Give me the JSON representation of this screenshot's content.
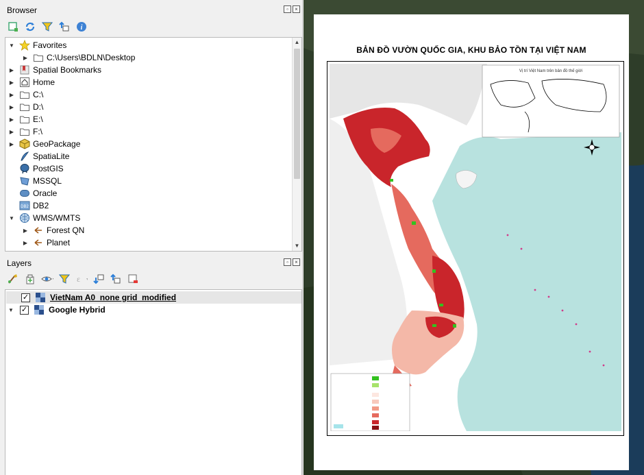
{
  "browser": {
    "title": "Browser",
    "toolbar_icons": [
      "add-layer-icon",
      "refresh-icon",
      "filter-icon",
      "collapse-all-icon",
      "info-icon"
    ],
    "items": [
      {
        "label": "Favorites",
        "icon": "star-icon",
        "expanded": true
      },
      {
        "label": "C:\\Users\\BDLN\\Desktop",
        "icon": "folder-icon"
      },
      {
        "label": "Spatial Bookmarks",
        "icon": "bookmark-icon"
      },
      {
        "label": "Home",
        "icon": "home-icon"
      },
      {
        "label": "C:\\",
        "icon": "folder-icon"
      },
      {
        "label": "D:\\",
        "icon": "folder-icon"
      },
      {
        "label": "E:\\",
        "icon": "folder-icon"
      },
      {
        "label": "F:\\",
        "icon": "folder-icon"
      },
      {
        "label": "GeoPackage",
        "icon": "geopackage-icon"
      },
      {
        "label": "SpatiaLite",
        "icon": "spatialite-icon"
      },
      {
        "label": "PostGIS",
        "icon": "postgis-icon"
      },
      {
        "label": "MSSQL",
        "icon": "mssql-icon"
      },
      {
        "label": "Oracle",
        "icon": "oracle-icon"
      },
      {
        "label": "DB2",
        "icon": "db2-icon"
      },
      {
        "label": "WMS/WMTS",
        "icon": "globe-icon",
        "expanded": true
      },
      {
        "label": "Forest QN",
        "icon": "wms-layer-icon"
      },
      {
        "label": "Planet",
        "icon": "wms-layer-icon"
      }
    ]
  },
  "layers": {
    "title": "Layers",
    "toolbar_icons": [
      "style-icon",
      "add-group-icon",
      "visibility-icon",
      "filter-icon",
      "expression-icon",
      "expand-all-icon",
      "collapse-all-icon",
      "remove-layer-icon"
    ],
    "items": [
      {
        "label": "VietNam A0_none grid_modified",
        "checked": true,
        "icon": "raster-icon"
      },
      {
        "label": "Google Hybrid",
        "checked": true,
        "icon": "raster-icon"
      }
    ]
  },
  "map": {
    "title": "BẢN ĐỒ VƯỜN QUỐC GIA, KHU BẢO TỒN TẠI VIỆT NAM",
    "inset_title": "Vị trí Việt Nam trên bản đồ thế giới",
    "colors": {
      "sea": "#b7e1de",
      "land": "#f2f2f2",
      "forest_dark": "#c9252b",
      "forest_mid": "#e56a5e",
      "forest_light": "#f4b8a8",
      "park_green": "#33c11f"
    }
  }
}
